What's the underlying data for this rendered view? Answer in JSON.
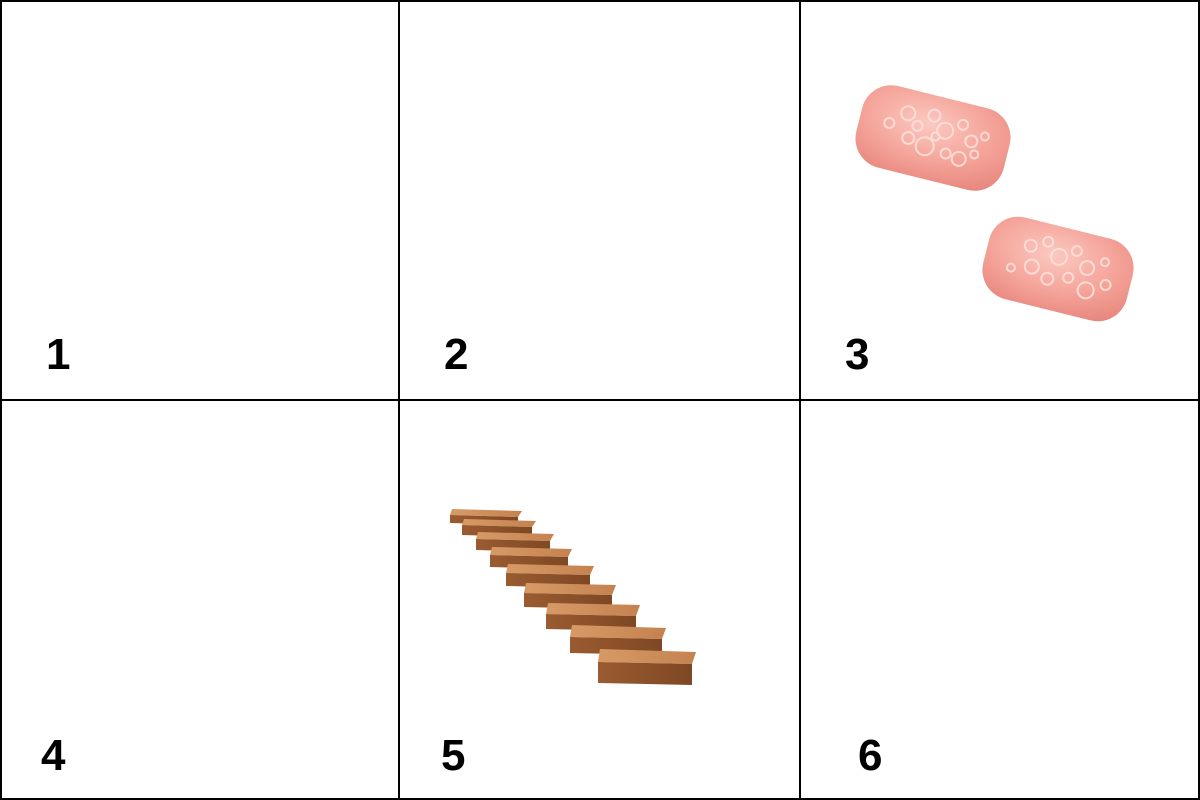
{
  "cells": [
    {
      "label": "1",
      "image": null
    },
    {
      "label": "2",
      "image": null
    },
    {
      "label": "3",
      "image": "two-pink-soap-bars"
    },
    {
      "label": "4",
      "image": null
    },
    {
      "label": "5",
      "image": "wooden-staircase"
    },
    {
      "label": "6",
      "image": null
    }
  ],
  "colors": {
    "border": "#000000",
    "background": "#ffffff",
    "soap": "#f4a39a",
    "wood": "#a8683c"
  }
}
